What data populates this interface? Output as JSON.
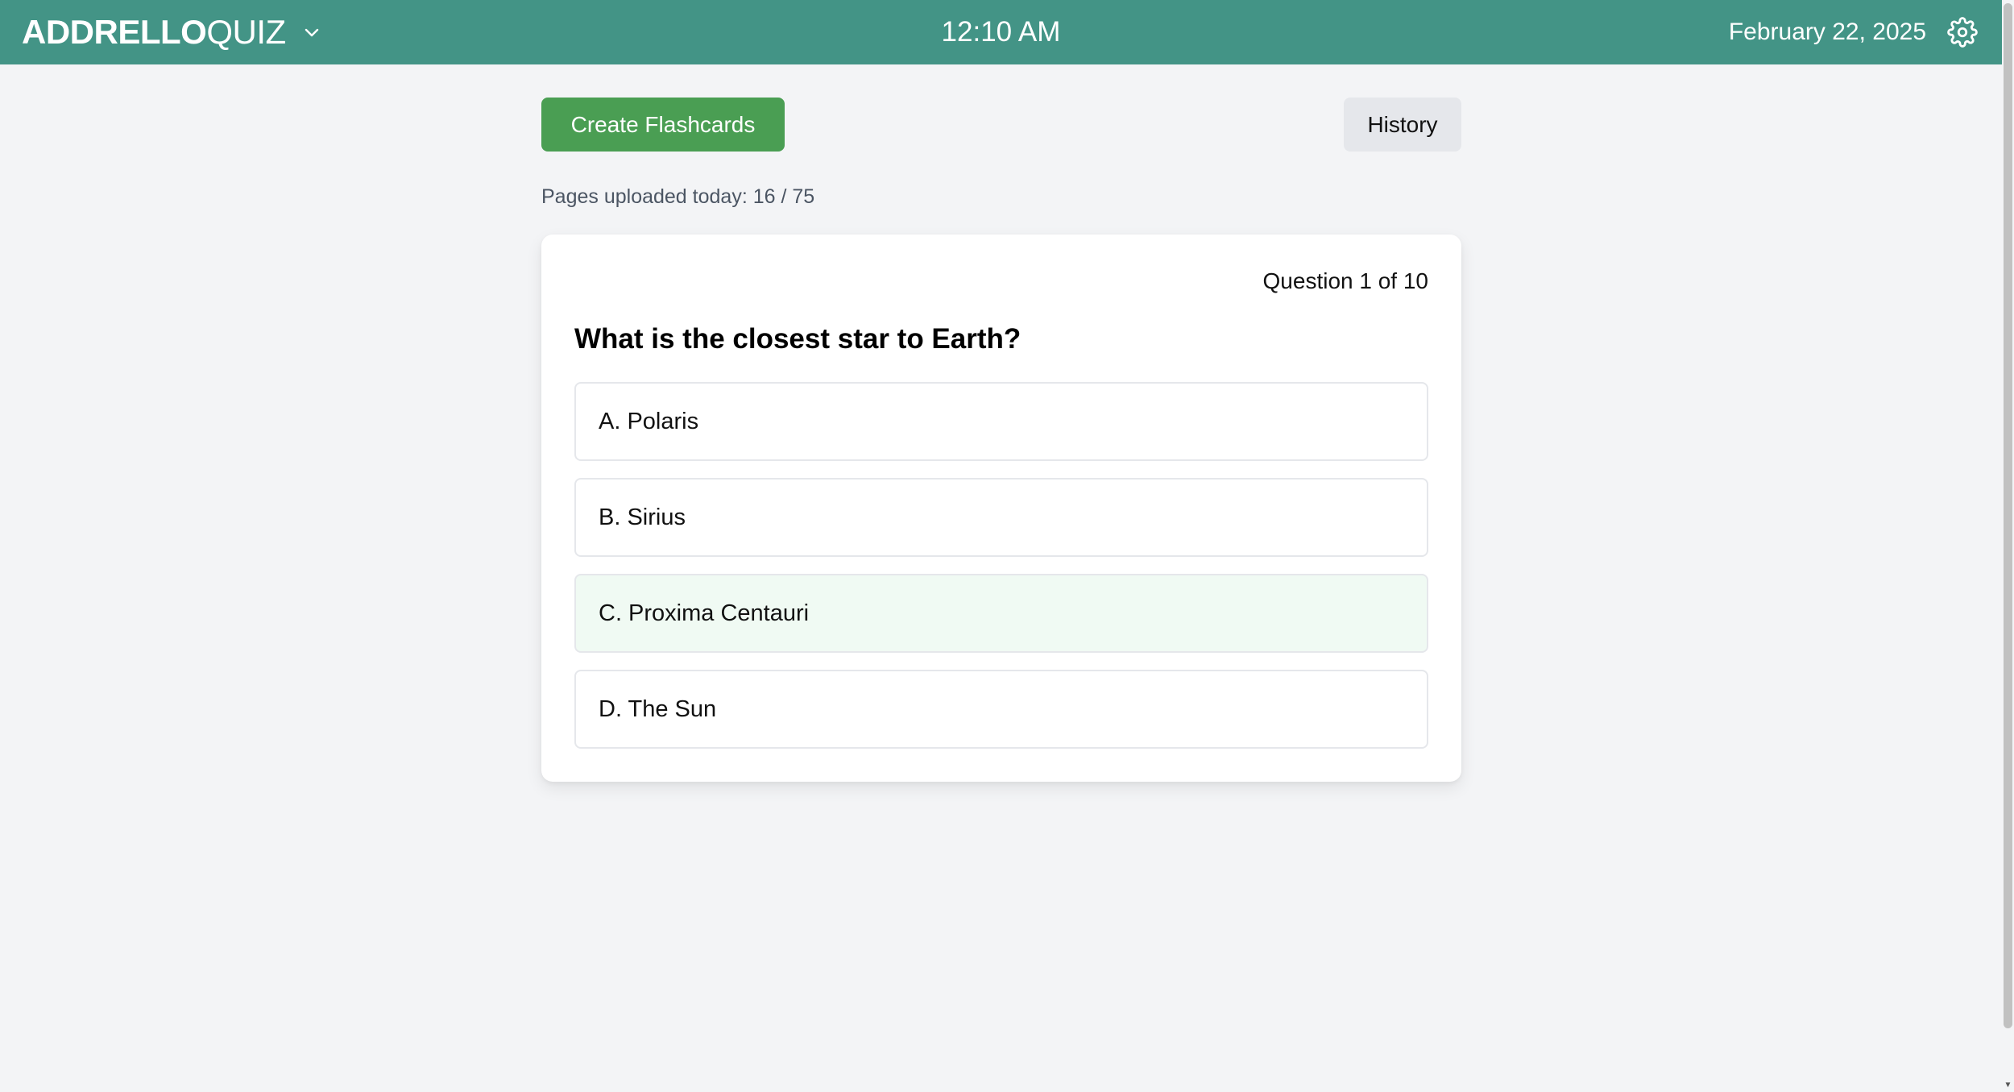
{
  "header": {
    "brand_bold": "ADDRELLO",
    "brand_light": "QUIZ",
    "time": "12:10 AM",
    "date": "February 22, 2025",
    "icons": {
      "dropdown": "chevron-down-icon",
      "settings": "gear-icon"
    },
    "background_color": "#439486"
  },
  "toolbar": {
    "create_label": "Create Flashcards",
    "create_color": "#4a9e53",
    "history_label": "History"
  },
  "uploads": {
    "text": "Pages uploaded today: 16 / 75"
  },
  "quiz": {
    "counter": "Question 1 of 10",
    "question": "What is the closest star to Earth?",
    "options": [
      {
        "label": "A. Polaris"
      },
      {
        "label": "B. Sirius"
      },
      {
        "label": "C. Proxima Centauri",
        "highlighted": true
      },
      {
        "label": "D. The Sun"
      }
    ]
  }
}
